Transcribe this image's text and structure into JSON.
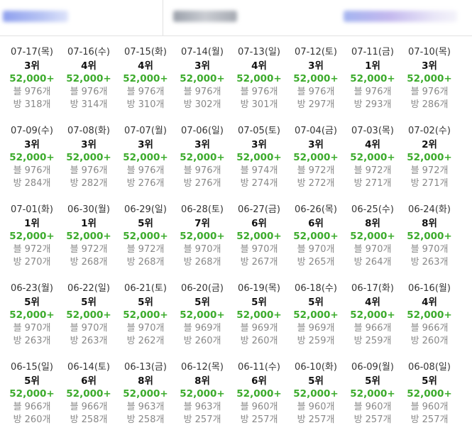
{
  "colors": {
    "count": "#3cab2c",
    "muted": "#888888",
    "text": "#111111"
  },
  "days": [
    {
      "date": "07-17(목)",
      "rank": "3위",
      "count": "52,000+",
      "blog": "블 976개",
      "room": "방 318개"
    },
    {
      "date": "07-16(수)",
      "rank": "4위",
      "count": "52,000+",
      "blog": "블 976개",
      "room": "방 314개"
    },
    {
      "date": "07-15(화)",
      "rank": "4위",
      "count": "52,000+",
      "blog": "블 976개",
      "room": "방 310개"
    },
    {
      "date": "07-14(월)",
      "rank": "3위",
      "count": "52,000+",
      "blog": "블 976개",
      "room": "방 302개"
    },
    {
      "date": "07-13(일)",
      "rank": "4위",
      "count": "52,000+",
      "blog": "블 976개",
      "room": "방 301개"
    },
    {
      "date": "07-12(토)",
      "rank": "3위",
      "count": "52,000+",
      "blog": "블 976개",
      "room": "방 297개"
    },
    {
      "date": "07-11(금)",
      "rank": "1위",
      "count": "52,000+",
      "blog": "블 976개",
      "room": "방 293개"
    },
    {
      "date": "07-10(목)",
      "rank": "3위",
      "count": "52,000+",
      "blog": "블 976개",
      "room": "방 286개"
    },
    {
      "date": "07-09(수)",
      "rank": "3위",
      "count": "52,000+",
      "blog": "블 976개",
      "room": "방 284개"
    },
    {
      "date": "07-08(화)",
      "rank": "3위",
      "count": "52,000+",
      "blog": "블 976개",
      "room": "방 282개"
    },
    {
      "date": "07-07(월)",
      "rank": "3위",
      "count": "52,000+",
      "blog": "블 976개",
      "room": "방 276개"
    },
    {
      "date": "07-06(일)",
      "rank": "3위",
      "count": "52,000+",
      "blog": "블 976개",
      "room": "방 276개"
    },
    {
      "date": "07-05(토)",
      "rank": "3위",
      "count": "52,000+",
      "blog": "블 974개",
      "room": "방 274개"
    },
    {
      "date": "07-04(금)",
      "rank": "3위",
      "count": "52,000+",
      "blog": "블 972개",
      "room": "방 272개"
    },
    {
      "date": "07-03(목)",
      "rank": "4위",
      "count": "52,000+",
      "blog": "블 972개",
      "room": "방 271개"
    },
    {
      "date": "07-02(수)",
      "rank": "2위",
      "count": "52,000+",
      "blog": "블 972개",
      "room": "방 271개"
    },
    {
      "date": "07-01(화)",
      "rank": "1위",
      "count": "52,000+",
      "blog": "블 972개",
      "room": "방 270개"
    },
    {
      "date": "06-30(월)",
      "rank": "1위",
      "count": "52,000+",
      "blog": "블 972개",
      "room": "방 268개"
    },
    {
      "date": "06-29(일)",
      "rank": "5위",
      "count": "52,000+",
      "blog": "블 972개",
      "room": "방 268개"
    },
    {
      "date": "06-28(토)",
      "rank": "7위",
      "count": "52,000+",
      "blog": "블 970개",
      "room": "방 268개"
    },
    {
      "date": "06-27(금)",
      "rank": "6위",
      "count": "52,000+",
      "blog": "블 970개",
      "room": "방 267개"
    },
    {
      "date": "06-26(목)",
      "rank": "6위",
      "count": "52,000+",
      "blog": "블 970개",
      "room": "방 265개"
    },
    {
      "date": "06-25(수)",
      "rank": "8위",
      "count": "52,000+",
      "blog": "블 970개",
      "room": "방 264개"
    },
    {
      "date": "06-24(화)",
      "rank": "8위",
      "count": "52,000+",
      "blog": "블 970개",
      "room": "방 263개"
    },
    {
      "date": "06-23(월)",
      "rank": "5위",
      "count": "52,000+",
      "blog": "블 970개",
      "room": "방 263개"
    },
    {
      "date": "06-22(일)",
      "rank": "5위",
      "count": "52,000+",
      "blog": "블 970개",
      "room": "방 263개"
    },
    {
      "date": "06-21(토)",
      "rank": "5위",
      "count": "52,000+",
      "blog": "블 970개",
      "room": "방 262개"
    },
    {
      "date": "06-20(금)",
      "rank": "5위",
      "count": "52,000+",
      "blog": "블 969개",
      "room": "방 260개"
    },
    {
      "date": "06-19(목)",
      "rank": "5위",
      "count": "52,000+",
      "blog": "블 969개",
      "room": "방 260개"
    },
    {
      "date": "06-18(수)",
      "rank": "5위",
      "count": "52,000+",
      "blog": "블 969개",
      "room": "방 259개"
    },
    {
      "date": "06-17(화)",
      "rank": "4위",
      "count": "52,000+",
      "blog": "블 966개",
      "room": "방 259개"
    },
    {
      "date": "06-16(월)",
      "rank": "4위",
      "count": "52,000+",
      "blog": "블 966개",
      "room": "방 260개"
    },
    {
      "date": "06-15(일)",
      "rank": "5위",
      "count": "52,000+",
      "blog": "블 966개",
      "room": "방 260개"
    },
    {
      "date": "06-14(토)",
      "rank": "6위",
      "count": "52,000+",
      "blog": "블 966개",
      "room": "방 258개"
    },
    {
      "date": "06-13(금)",
      "rank": "8위",
      "count": "52,000+",
      "blog": "블 963개",
      "room": "방 258개"
    },
    {
      "date": "06-12(목)",
      "rank": "8위",
      "count": "52,000+",
      "blog": "블 963개",
      "room": "방 257개"
    },
    {
      "date": "06-11(수)",
      "rank": "6위",
      "count": "52,000+",
      "blog": "블 960개",
      "room": "방 257개"
    },
    {
      "date": "06-10(화)",
      "rank": "5위",
      "count": "52,000+",
      "blog": "블 960개",
      "room": "방 257개"
    },
    {
      "date": "06-09(월)",
      "rank": "5위",
      "count": "52,000+",
      "blog": "블 960개",
      "room": "방 257개"
    },
    {
      "date": "06-08(일)",
      "rank": "5위",
      "count": "52,000+",
      "blog": "블 960개",
      "room": "방 257개"
    }
  ]
}
